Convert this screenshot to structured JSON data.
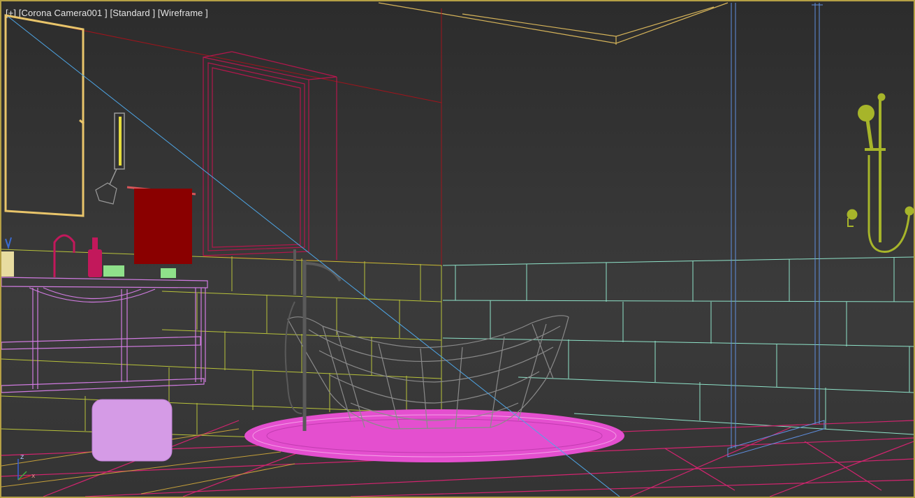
{
  "viewport": {
    "label_pov": "[+]",
    "label_camera": "[Corona Camera001 ]",
    "label_shading_mode": "[Standard ]",
    "label_render_mode": "[Wireframe ]",
    "border_color": "#b5a045"
  },
  "axis_gizmo": {
    "z_label": "z",
    "x_label": "x"
  },
  "colors": {
    "tile_wall": "#b8c23a",
    "tile_wall_right": "#8fe3c9",
    "floor_tiles": "#d3246f",
    "window": "#b3174c",
    "vanity": "#d07be0",
    "bathtub": "#8a8a8a",
    "rug": "#e44fcf",
    "stool": "#d59be6",
    "towel": "#8a0000",
    "mirror": "#e8c46a",
    "shower_glass": "#5f8fe0",
    "shower_set": "#a7b52a",
    "ceiling": "#d6b45a"
  }
}
